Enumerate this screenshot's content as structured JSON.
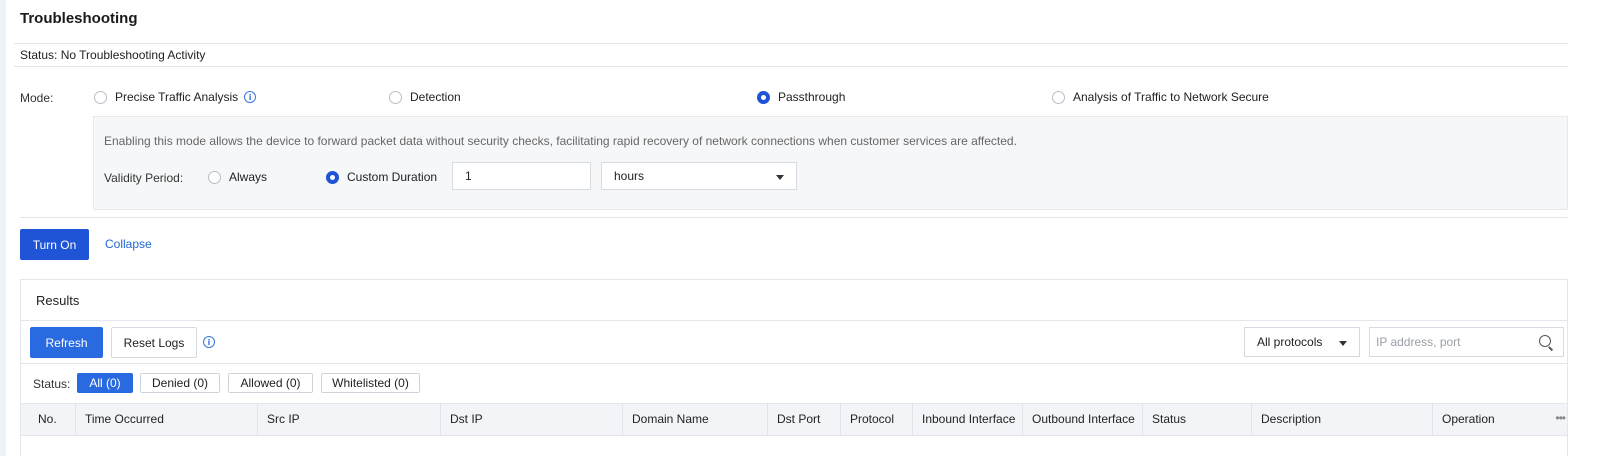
{
  "page": {
    "title": "Troubleshooting",
    "status_text": "Status: No Troubleshooting Activity"
  },
  "mode": {
    "label": "Mode:",
    "options": [
      {
        "label": "Precise Traffic Analysis",
        "checked": false,
        "has_info_icon": true
      },
      {
        "label": "Detection",
        "checked": false
      },
      {
        "label": "Passthrough",
        "checked": true
      },
      {
        "label": "Analysis of Traffic to Network Secure",
        "checked": false
      }
    ],
    "description": "Enabling this mode allows the device to forward packet data without security checks, facilitating rapid recovery of network connections when customer services are affected.",
    "validity": {
      "label": "Validity Period:",
      "options": [
        {
          "label": "Always",
          "checked": false
        },
        {
          "label": "Custom Duration",
          "checked": true
        }
      ],
      "duration_value": "1",
      "unit_value": "hours"
    }
  },
  "actions": {
    "turn_on": "Turn On",
    "collapse": "Collapse"
  },
  "results": {
    "title": "Results",
    "refresh": "Refresh",
    "reset_logs": "Reset Logs",
    "protocol_select": "All protocols",
    "search_placeholder": "IP address, port",
    "status_label": "Status:",
    "filters": [
      {
        "label": "All (0)",
        "active": true
      },
      {
        "label": "Denied (0)",
        "active": false
      },
      {
        "label": "Allowed (0)",
        "active": false
      },
      {
        "label": "Whitelisted (0)",
        "active": false
      }
    ],
    "columns": [
      "No.",
      "Time Occurred",
      "Src IP",
      "Dst IP",
      "Domain Name",
      "Dst Port",
      "Protocol",
      "Inbound Interface",
      "Outbound Interface",
      "Status",
      "Description",
      "Operation"
    ],
    "more_glyph": "•••"
  },
  "colors": {
    "primary": "#1f54d6",
    "link": "#1f67d2",
    "chip_active": "#2a6ae0",
    "table_header_bg": "#f2f4f7",
    "panel_bg": "#f6f7f9"
  },
  "icons": {
    "info": "info-icon",
    "search": "search-icon",
    "caret": "chevron-down-icon",
    "more": "more-icon"
  }
}
